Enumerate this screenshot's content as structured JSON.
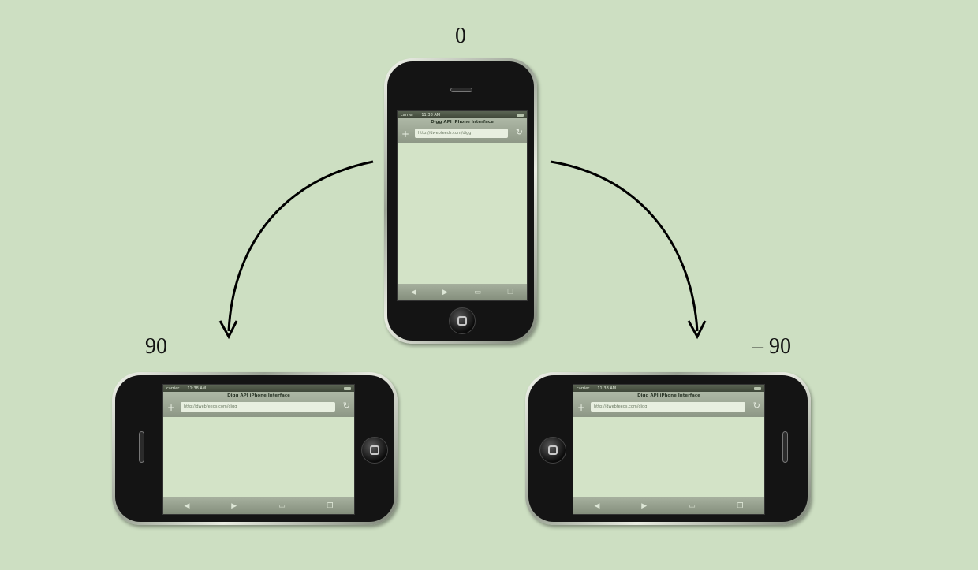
{
  "labels": {
    "top": "0",
    "left": "90",
    "right": "– 90"
  },
  "phone_ui": {
    "carrier": "carrier",
    "time": "11:38 AM",
    "page_title": "Digg API iPhone Interface",
    "url": "http://dwebfeeds.com/digg"
  },
  "colors": {
    "background": "#cddfc2",
    "screen": "#d3e3c7",
    "arrow": "#000000"
  }
}
